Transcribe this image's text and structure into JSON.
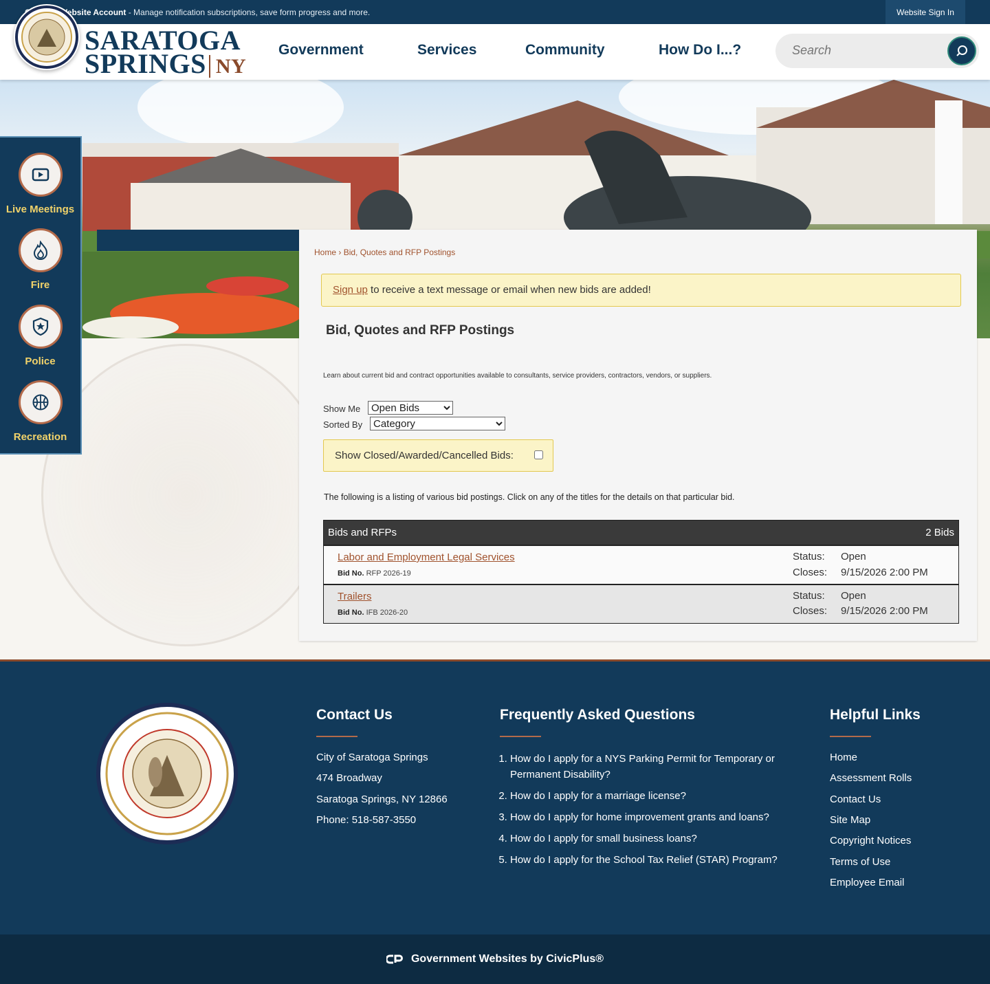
{
  "topbar": {
    "create_bold": "Create a Website Account",
    "create_rest": " - Manage notification subscriptions, save form progress and more.",
    "signin": "Website Sign In"
  },
  "header": {
    "brand_line1": "SARATOGA",
    "brand_line2": "SPRINGS",
    "brand_ny": "NY",
    "nav": [
      "Government",
      "Services",
      "Community",
      "How Do I...?"
    ],
    "search_placeholder": "Search"
  },
  "quick_links": [
    {
      "label": "Live Meetings",
      "icon": "video-play-icon"
    },
    {
      "label": "Fire",
      "icon": "flame-icon"
    },
    {
      "label": "Police",
      "icon": "police-badge-icon"
    },
    {
      "label": "Recreation",
      "icon": "basketball-icon"
    }
  ],
  "content": {
    "breadcrumb_home": "Home",
    "breadcrumb_sep": " › ",
    "breadcrumb_current": "Bid, Quotes and RFP Postings",
    "alert_link": "Sign up",
    "alert_text": " to receive a text message or email when new bids are added!",
    "title": "Bid, Quotes and RFP Postings",
    "intro": "Learn about current bid and contract opportunities available to consultants, service providers, contractors, vendors, or suppliers.",
    "show_me_label": "Show Me",
    "show_me_value": "Open Bids",
    "sorted_by_label": "Sorted By",
    "sorted_by_value": "Category",
    "closed_label": "Show Closed/Awarded/Cancelled Bids:",
    "listing_note": "The following is a listing of various bid postings. Click on any of the titles for the details on that particular bid.",
    "table_title": "Bids and RFPs",
    "table_count": "2 Bids",
    "bids": [
      {
        "title": "Labor and Employment Legal Services",
        "no_label": "Bid No.",
        "no": "RFP 2026-19",
        "status_label": "Status:",
        "status": "Open",
        "closes_label": "Closes:",
        "closes": "9/15/2026 2:00 PM"
      },
      {
        "title": "Trailers",
        "no_label": "Bid No.",
        "no": "IFB 2026-20",
        "status_label": "Status:",
        "status": "Open",
        "closes_label": "Closes:",
        "closes": "9/15/2026 2:00 PM"
      }
    ]
  },
  "footer": {
    "contact_title": "Contact Us",
    "contact_lines": [
      "City of Saratoga Springs",
      "474 Broadway",
      "Saratoga Springs, NY 12866",
      "Phone: 518-587-3550"
    ],
    "faq_title": "Frequently Asked Questions",
    "faq": [
      "How do I apply for a NYS Parking Permit for Temporary or Permanent Disability?",
      "How do I apply for a marriage license?",
      "How do I apply for home improvement grants and loans?",
      "How do I apply for small business loans?",
      "How do I apply for the School Tax Relief (STAR) Program?"
    ],
    "links_title": "Helpful Links",
    "links": [
      "Home",
      "Assessment Rolls",
      "Contact Us",
      "Site Map",
      "Copyright Notices",
      "Terms of Use",
      "Employee Email"
    ],
    "civicplus": "Government Websites by CivicPlus®"
  },
  "colors": {
    "navy": "#123a5a",
    "rust": "#a0522d",
    "gold": "#f2d36a",
    "alert_bg": "#fbf4c8"
  }
}
